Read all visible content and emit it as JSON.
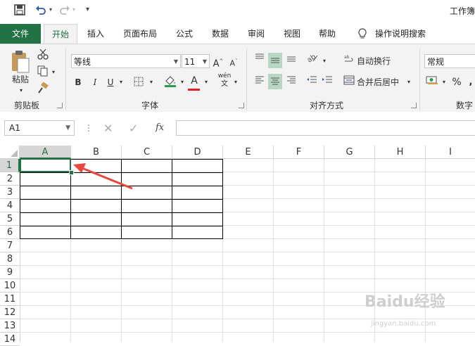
{
  "title_bar": {
    "doc_title": "工作簿"
  },
  "tabs": [
    {
      "label": "文件"
    },
    {
      "label": "开始"
    },
    {
      "label": "插入"
    },
    {
      "label": "页面布局"
    },
    {
      "label": "公式"
    },
    {
      "label": "数据"
    },
    {
      "label": "审阅"
    },
    {
      "label": "视图"
    },
    {
      "label": "帮助"
    },
    {
      "label": "操作说明搜索"
    }
  ],
  "ribbon": {
    "clipboard": {
      "paste_label": "粘贴",
      "group_label": "剪贴板"
    },
    "font": {
      "font_name": "等线",
      "font_size": "11",
      "bold": "B",
      "italic": "I",
      "underline": "U",
      "grow": "A",
      "shrink": "A",
      "font_color_letter": "A",
      "wen": "wén",
      "group_label": "字体"
    },
    "alignment": {
      "wrap_text": "自动换行",
      "merge_center": "合并后居中",
      "group_label": "对齐方式"
    },
    "number": {
      "format": "常规",
      "percent": "%",
      "group_label": "数字"
    }
  },
  "formula_bar": {
    "name_box": "A1",
    "fx": "fx"
  },
  "grid": {
    "columns": [
      "A",
      "B",
      "C",
      "D",
      "E",
      "F",
      "G",
      "H",
      "I"
    ],
    "rows": [
      "1",
      "2",
      "3",
      "4",
      "5",
      "6",
      "7",
      "8",
      "9",
      "10",
      "11",
      "12",
      "13",
      "14"
    ],
    "selected_cell": "A1"
  },
  "colors": {
    "accent": "#217346",
    "arrow": "#e8473d"
  },
  "watermark": {
    "text": "Baidu经验",
    "url": "jingyan.baidu.com"
  }
}
